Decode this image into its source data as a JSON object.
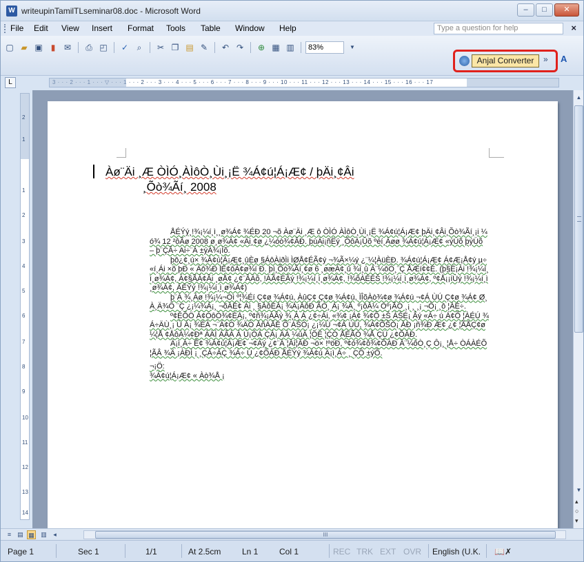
{
  "window": {
    "title": "writeupinTamilTLseminar08.doc - Microsoft Word",
    "app_icon_glyph": "W"
  },
  "window_buttons": {
    "minimize": "–",
    "maximize": "□",
    "close": "✕"
  },
  "menu": {
    "items": [
      "File",
      "Edit",
      "View",
      "Insert",
      "Format",
      "Tools",
      "Table",
      "Window",
      "Help"
    ],
    "help_placeholder": "Type a question for help",
    "close_glyph": "×"
  },
  "toolbar": {
    "zoom": "83%",
    "anjal_label": "Anjal Converter",
    "icons": [
      "new-icon",
      "open-icon",
      "save-icon",
      "permission-icon",
      "email-icon",
      "print-icon",
      "print-preview-icon",
      "spelling-icon",
      "research-icon",
      "cut-icon",
      "copy-icon",
      "paste-icon",
      "format-painter-icon",
      "undo-icon",
      "redo-icon",
      "hyperlink-icon",
      "tables-icon",
      "insert-table-icon"
    ]
  },
  "ruler": {
    "marks": "3 · · · 2 · · · 1 · · · ▽ · · · 1 · · · 2 · · · 3 · · · 4 · · · 5 · · · 6 · · · 7 · · · 8 · · · 9 · · · 10 · · · 11 · · · 12 · · · 13 · · · 14 · · · 15 · · · 16 · · · 17",
    "corner": "L",
    "vertical_marks": [
      "2",
      "1",
      "1",
      "2",
      "3",
      "4",
      "5",
      "6",
      "7",
      "8",
      "9",
      "10",
      "11",
      "12",
      "13",
      "14"
    ]
  },
  "document": {
    "title_line1": "Àø¨Äi ¸Æ ÒÌÓ¸ÀÌôÒ¸Ùi¸¡Ë    ¾Á¢ú¦Á¡Æ¢ / þÄi¸¢Âi",
    "title_line2": "¸Õò¾Ãí¸ 2008",
    "paragraphs": [
      "ÅÉÝý¸!¾¡¼í¸ì¸¸ø¾Á¢ ¾ÉÐ 20 ¬õ Àø¨Äi ¸Æ ô ÒÌÓ ÀÌôÒ¸Ùi¸¡Ë ¾Á¢ú¦Á¡Æ¢ þÄi¸¢Âi¸Õò¾Ãí¸¡i ¼ó¾ 12 ²ôÃø 2008 ø¸ø¾Á¢ «Äi¸¢ø ¿¼óò¾¢ÂÐ. þùÄi¡ñËý ¸ÕôÀ¡Ûõ ºéí¸Àøø ¾Á¢ú¦Á¡Æ¢ «ýÚõ þýÚõ – þ¨ÇÂ÷ Ai÷¨Á ±ýÀ¾¡Ìõ.",
      "þô¿¢¸ú× ¾Á¢ú¦Á¡Æ¢¸ûÈø §ÁôÀiðÌi ÌØÅ¢ÉÃ¢ý ¬¾Ã×¼ý ¿¨¼¦ÀüÈÐ. ¾Á¢ú¦Á¡Æ¢ Á¢Æ¡Å¢ý µ÷ «í¸Ái ×õ þÐ « Äô¾Ð lÉ¢ôÀ¢ø¾í Ð. þì¸Õò¾Ãí¸¢ø 6 ¸øæÁ¢¸û ¾í¸û Á¨¼ôÒ¸¨Ç ÅÆí¢¢É. (þ§Ë¡Ái !¾¡¼í¸ì¸ø¾Á¢, Á¢§ÃÁ¢Âi ¸øÅ¢ ¿¢¨ÂÄõ, !ÁÃ¢ÉÂý !¾¡¼í¸ì¸ø¾Á¢, !¾õÀÉÉŠ !¾¡¼í¸ì¸ø¾Á¢, º¢Å¡¡íÙý !¾¡¼í¸ì¸ø¾Á¢, ÁÉÝý !¾¡¼í¸ì¸ø¾Á¢)",
      "þ¨Á ¾¸Áø !¾¡¼¬Òì º¦¾Éí Ç¢ø ¾Á¢ú, ÀûÇ¢ Ç¢ø ¾Á¢ú, ÌÎõÀò¾¢ø ¾Á¢ú ¬¢Á ÙÚ Ç¢ø ¾Á¢ Ø¸ À¸Ä¾Ô ¨Ç ¿¡¼¾Á¡¸ ¬õÀÉ¢ Ái ¸ §ÀôÉÁ¡ ¾Á¡ÁôÐ ÃÒ¸ Á¡ ¾Ä¸ º¡ôÀ¼ Òº¡ÃÒ ¸¡ ¸ ¸¡ ¬Ô¡ ¸ô ¦ÀÉ÷.",
      "º¢ÉÕÖ Á¢ÓôÒ¾¢ÉÁ¡, º¢ñ¾¡ÁÂý ¾¸Á Á ¿¢÷Ái, «¾¢ ¡Á¢ ¾¢Õ ±Š ÀŠÉ¡ Âý «Á÷ ú Á¢Õ ¦ÀÉÚ ¾Á÷ÄÙ¸¡ Ù Á¡ ¾ÉÀ ¬¨Á¢Ò ¾ÄÒ ÀñÀÂÉ Õ¨ÁŠÒ¡ ¿¡¼Ù ¬¢Á ÙÚ, ¾Á¢ÕŠÒ¡ ÀÐ ¡ñ¾Ð Æ¢ ¿¢ ¦ÃÅÇ¢ø¼¦Å ¢ÅôÀ¼¢Ðª ÀÄÌ ÁÂÀ Á Ù¡ÔÁ ÇÁ¡ ÄÀ ¼ûÄ ¦ÕÉ ¦ÇÒ ÅÉÃÒ ¾Å ÇÚ ¿¢ÕÀÐ.",
      "Ä¡ì¸Á÷ Ê¢ ¾Á¢ú¦Á¡Æ¢ ¬¢Áý ¿¢¨Ä ¦Àì¦ÀÐ ¬ö× !ºöÐ, º¢ó¾¢ô¾¢ÕÀÐ À¨¼ôÒ¸Ç Ô¡¸ ¦Å÷ ÒÁÀÉÕ ¦ÃÂ ¾Ä ¡ÀÐÌ ¡ ¸ÇÁ÷ÁÇ ¾Á÷ Ú ¿¢ÕÀÐ ÅÉÝý ¾Á¢ú Ä¡ì¸Á÷ ¸ ÇÔ ±ýÕ.",
      "¬¡Ö:",
      "¾Á¢ú¦Á¡Æ¢ « Àò¾Å ¡"
    ]
  },
  "scrollbar": {
    "up": "▲",
    "down": "▼",
    "prev_page": "▴",
    "select_browse": "○",
    "next_page": "▾",
    "hscroll_grip": "III"
  },
  "view_buttons": [
    "≡",
    "▤",
    "▦",
    "▥",
    "◂"
  ],
  "status": {
    "page": "Page 1",
    "section": "Sec 1",
    "page_of": "1/1",
    "at": "At 2.5cm",
    "line": "Ln 1",
    "col": "Col 1",
    "rec": "REC",
    "trk": "TRK",
    "ext": "EXT",
    "ovr": "OVR",
    "language": "English (U.K.",
    "spell_icon": "📖✗"
  },
  "colors": {
    "accent_highlight": "#e0211c",
    "anjal_bg": "#fbe6a6",
    "doc_bg": "#8d9db5"
  }
}
